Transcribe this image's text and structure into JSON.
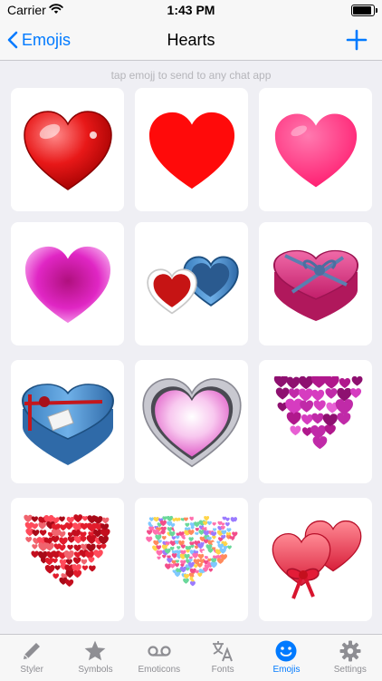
{
  "status": {
    "carrier": "Carrier",
    "time": "1:43 PM",
    "battery_level": 1.0
  },
  "nav": {
    "back_label": "Emojis",
    "title": "Hearts"
  },
  "hint": "tap emojj to send to any chat app",
  "grid": {
    "items": [
      {
        "name": "glossy-red-heart"
      },
      {
        "name": "flat-red-heart"
      },
      {
        "name": "pink-heart"
      },
      {
        "name": "glowing-magenta-heart"
      },
      {
        "name": "chocolate-box-hearts"
      },
      {
        "name": "pink-gift-box-heart"
      },
      {
        "name": "blue-gift-box-heart"
      },
      {
        "name": "silver-pink-heart"
      },
      {
        "name": "purple-hearts-cluster"
      },
      {
        "name": "red-mosaic-heart"
      },
      {
        "name": "confetti-heart"
      },
      {
        "name": "twin-hearts-bow"
      }
    ]
  },
  "tabs": [
    {
      "id": "styler",
      "label": "Styler",
      "icon": "pencil-icon"
    },
    {
      "id": "symbols",
      "label": "Symbols",
      "icon": "star-icon"
    },
    {
      "id": "emoticons",
      "label": "Emoticons",
      "icon": "voicemail-icon"
    },
    {
      "id": "fonts",
      "label": "Fonts",
      "icon": "translate-icon"
    },
    {
      "id": "emojis",
      "label": "Emojis",
      "icon": "smiley-icon",
      "active": true
    },
    {
      "id": "settings",
      "label": "Settings",
      "icon": "gear-icon"
    }
  ],
  "colors": {
    "accent": "#007aff",
    "inactive": "#8e8e93",
    "background": "#efeff4"
  }
}
